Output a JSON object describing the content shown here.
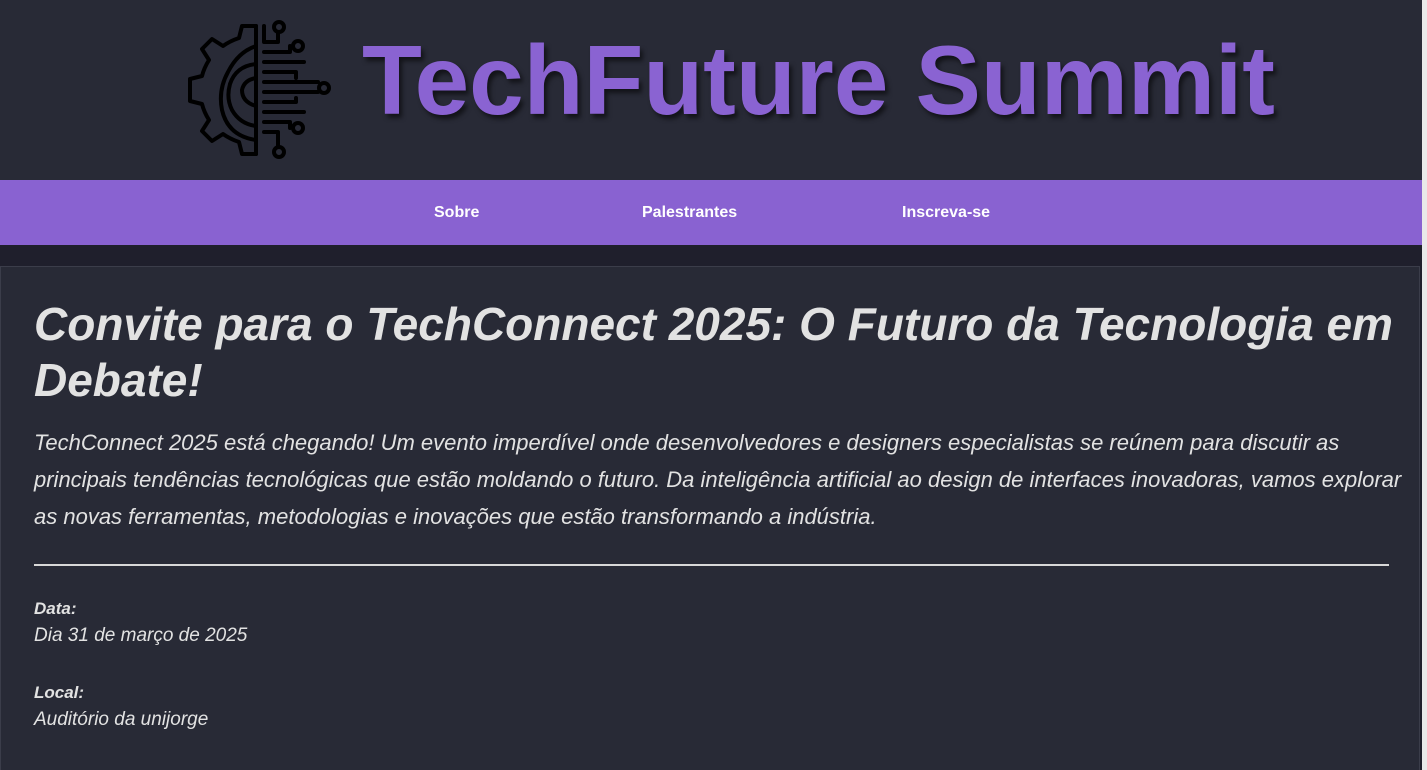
{
  "header": {
    "logo_icon": "circuit-gear-icon",
    "title": "TechFuture Summit"
  },
  "nav": {
    "items": [
      {
        "label": "Sobre"
      },
      {
        "label": "Palestrantes"
      },
      {
        "label": "Inscreva-se"
      }
    ]
  },
  "colors": {
    "accent": "#8962d1",
    "background": "#282a36",
    "text": "#e2e2e2"
  },
  "main": {
    "title": "Convite para o TechConnect 2025: O Futuro da Tecnologia em Debate!",
    "description": "TechConnect 2025 está chegando! Um evento imperdível onde desenvolvedores e designers especialistas se reúnem para discutir as principais tendências tecnológicas que estão moldando o futuro. Da inteligência artificial ao design de interfaces inovadoras, vamos explorar as novas ferramentas, metodologias e inovações que estão transformando a indústria.",
    "date_label": "Data:",
    "date_value": "Dia 31 de março de 2025",
    "location_label": "Local:",
    "location_value": "Auditório da unijorge"
  }
}
